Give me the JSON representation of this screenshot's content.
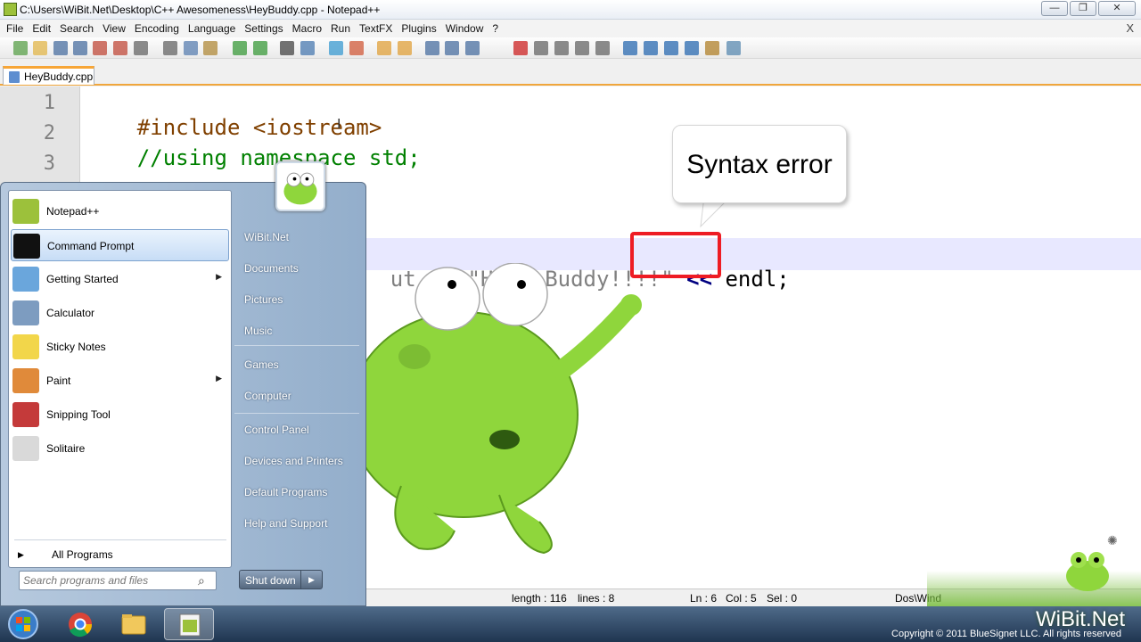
{
  "window": {
    "title": "C:\\Users\\WiBit.Net\\Desktop\\C++ Awesomeness\\HeyBuddy.cpp - Notepad++",
    "controls": {
      "minimize": "—",
      "maximize": "❐",
      "close": "✕"
    }
  },
  "menu": {
    "items": [
      "File",
      "Edit",
      "Search",
      "View",
      "Encoding",
      "Language",
      "Settings",
      "Macro",
      "Run",
      "TextFX",
      "Plugins",
      "Window",
      "?"
    ],
    "close_glyph": "X"
  },
  "tab": {
    "label": "HeyBuddy.cpp"
  },
  "editor": {
    "line_numbers": [
      "1",
      "2",
      "3"
    ],
    "lines": {
      "l1": {
        "pre": "#include <iostream>"
      },
      "l2": {
        "comment": "//using namespace std;"
      },
      "l6": {
        "str": "ut << \"Hey, Buddy!!!!\"",
        "op": " << ",
        "id": "endl;"
      }
    }
  },
  "callout": {
    "text": "Syntax error"
  },
  "statusbar": {
    "length": "length : 116",
    "lines": "lines : 8",
    "ln": "Ln : 6",
    "col": "Col : 5",
    "sel": "Sel : 0",
    "eol": "Dos\\Wind"
  },
  "start_menu": {
    "programs": [
      {
        "label": "Notepad++",
        "icon": "notepad-plus-plus-icon",
        "submenu": false
      },
      {
        "label": "Command Prompt",
        "icon": "command-prompt-icon",
        "submenu": false,
        "selected": true
      },
      {
        "label": "Getting Started",
        "icon": "getting-started-icon",
        "submenu": true
      },
      {
        "label": "Calculator",
        "icon": "calculator-icon",
        "submenu": false
      },
      {
        "label": "Sticky Notes",
        "icon": "sticky-notes-icon",
        "submenu": false
      },
      {
        "label": "Paint",
        "icon": "paint-icon",
        "submenu": true
      },
      {
        "label": "Snipping Tool",
        "icon": "scissors-icon",
        "submenu": false
      },
      {
        "label": "Solitaire",
        "icon": "cards-icon",
        "submenu": false
      }
    ],
    "all_programs": "All Programs",
    "search_placeholder": "Search programs and files",
    "places": [
      "WiBit.Net",
      "Documents",
      "Pictures",
      "Music",
      "Games",
      "Computer",
      "Control Panel",
      "Devices and Printers",
      "Default Programs",
      "Help and Support"
    ],
    "shutdown": "Shut down"
  },
  "branding": {
    "watermark": "WiBit.Net",
    "copyright": "Copyright © 2011 BlueSignet LLC. All rights reserved"
  },
  "colors": {
    "highlight_box": "#ee1c24",
    "tab_accent": "#f7a638",
    "frog": "#8fd63c"
  }
}
